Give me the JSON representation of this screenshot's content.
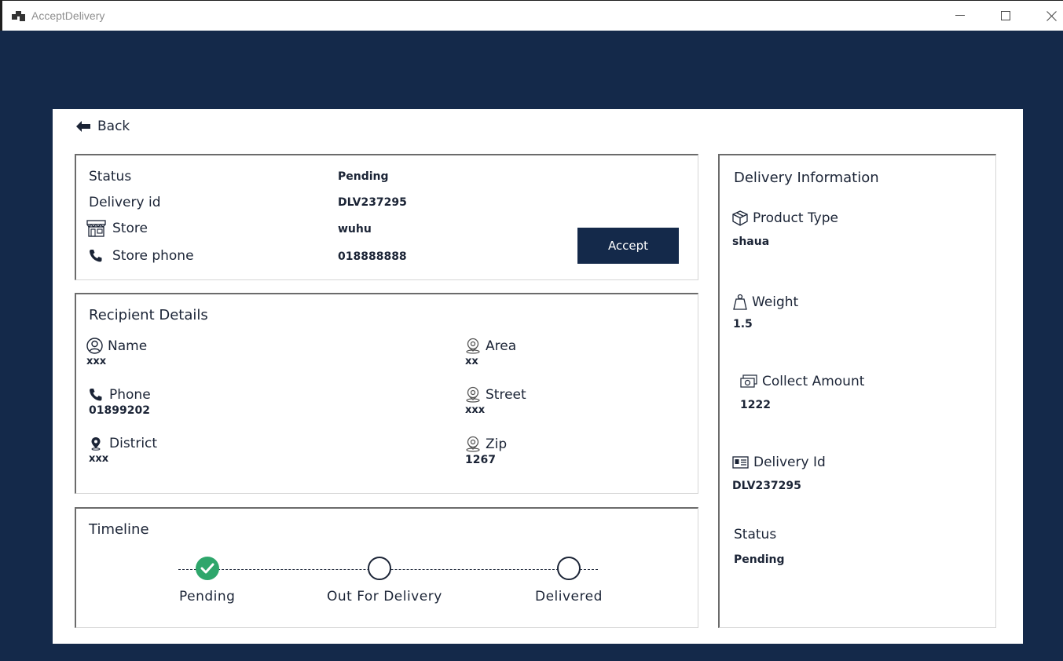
{
  "window": {
    "title": "AcceptDelivery",
    "icon": "app-window-icon"
  },
  "nav": {
    "back_label": "Back",
    "back_icon": "arrow-left-icon"
  },
  "status_card": {
    "rows": [
      {
        "label": "Status",
        "value": "Pending"
      },
      {
        "label": "Delivery id",
        "value": "DLV237295"
      },
      {
        "label": "Store",
        "value": "wuhu",
        "icon": "store-icon"
      },
      {
        "label": "Store phone",
        "value": "018888888",
        "icon": "phone-icon"
      }
    ],
    "accept_label": "Accept"
  },
  "recipient": {
    "title": "Recipient Details",
    "name": {
      "label": "Name",
      "value": "xxx",
      "icon": "user-circle-icon"
    },
    "phone": {
      "label": "Phone",
      "value": "01899202",
      "icon": "phone-icon"
    },
    "district": {
      "label": "District",
      "value": "xxx",
      "icon": "map-pin-icon"
    },
    "area": {
      "label": "Area",
      "value": "xx",
      "icon": "location-icon"
    },
    "street": {
      "label": "Street",
      "value": "xxx",
      "icon": "location-icon"
    },
    "zip": {
      "label": "Zip",
      "value": "1267",
      "icon": "location-icon"
    }
  },
  "timeline": {
    "title": "Timeline",
    "steps": [
      {
        "label": "Pending",
        "state": "done"
      },
      {
        "label": "Out For Delivery",
        "state": "pending"
      },
      {
        "label": "Delivered",
        "state": "pending"
      }
    ],
    "done_color": "#2ea66b"
  },
  "delivery_info": {
    "title": "Delivery Information",
    "product_type": {
      "label": "Product Type",
      "value": "shaua",
      "icon": "package-icon"
    },
    "weight": {
      "label": "Weight",
      "value": "1.5",
      "icon": "weight-icon"
    },
    "collect_amount": {
      "label": "Collect Amount",
      "value": "1222",
      "icon": "money-icon"
    },
    "delivery_id": {
      "label": "Delivery Id",
      "value": "DLV237295",
      "icon": "id-card-icon"
    },
    "status": {
      "label": "Status",
      "value": "Pending"
    }
  },
  "colors": {
    "background": "#14294a",
    "accent_button": "#14294a",
    "text": "#1b2436"
  }
}
